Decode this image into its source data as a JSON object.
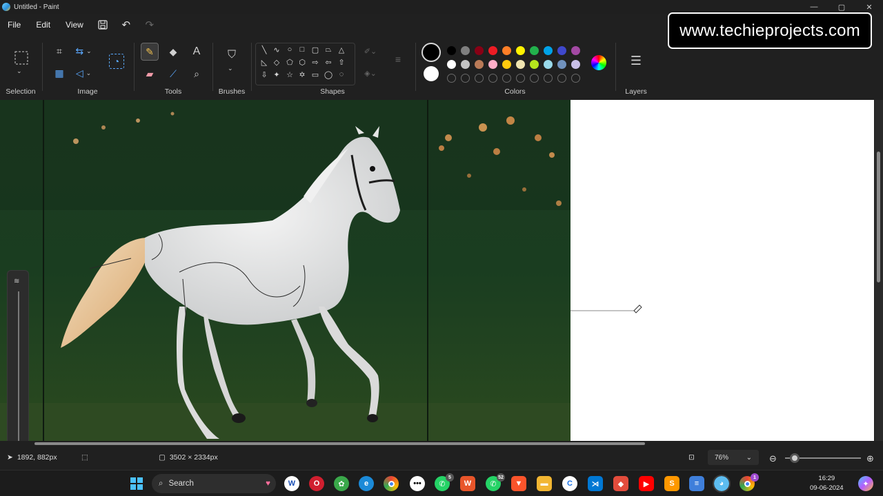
{
  "titlebar": {
    "title": "Untitled - Paint",
    "min": "—",
    "max": "▢",
    "close": "✕"
  },
  "menu": {
    "file": "File",
    "edit": "Edit",
    "view": "View"
  },
  "ribbon": {
    "groups": {
      "selection": "Selection",
      "image": "Image",
      "tools": "Tools",
      "brushes": "Brushes",
      "shapes": "Shapes",
      "colors": "Colors",
      "layers": "Layers"
    }
  },
  "colors": {
    "primary": "#000000",
    "secondary": "#ffffff",
    "row1": [
      "#000000",
      "#7f7f7f",
      "#880015",
      "#ed1c24",
      "#ff7f27",
      "#fff200",
      "#22b14c",
      "#00a2e8",
      "#3f48cc",
      "#a349a4"
    ],
    "row2": [
      "#ffffff",
      "#c3c3c3",
      "#b97a57",
      "#ffaec9",
      "#ffc90e",
      "#efe4b0",
      "#b5e61d",
      "#99d9ea",
      "#7092be",
      "#c8bfe7"
    ]
  },
  "status": {
    "cursor": "1892, 882px",
    "canvas_size": "3502 × 2334px",
    "zoom": "76%"
  },
  "taskbar": {
    "search": "Search",
    "time": "16:29",
    "date": "09-06-2024",
    "badges": {
      "whatsapp1": "5",
      "whatsapp2": "52",
      "chrome": "1"
    }
  },
  "watermark": "www.techieprojects.com"
}
